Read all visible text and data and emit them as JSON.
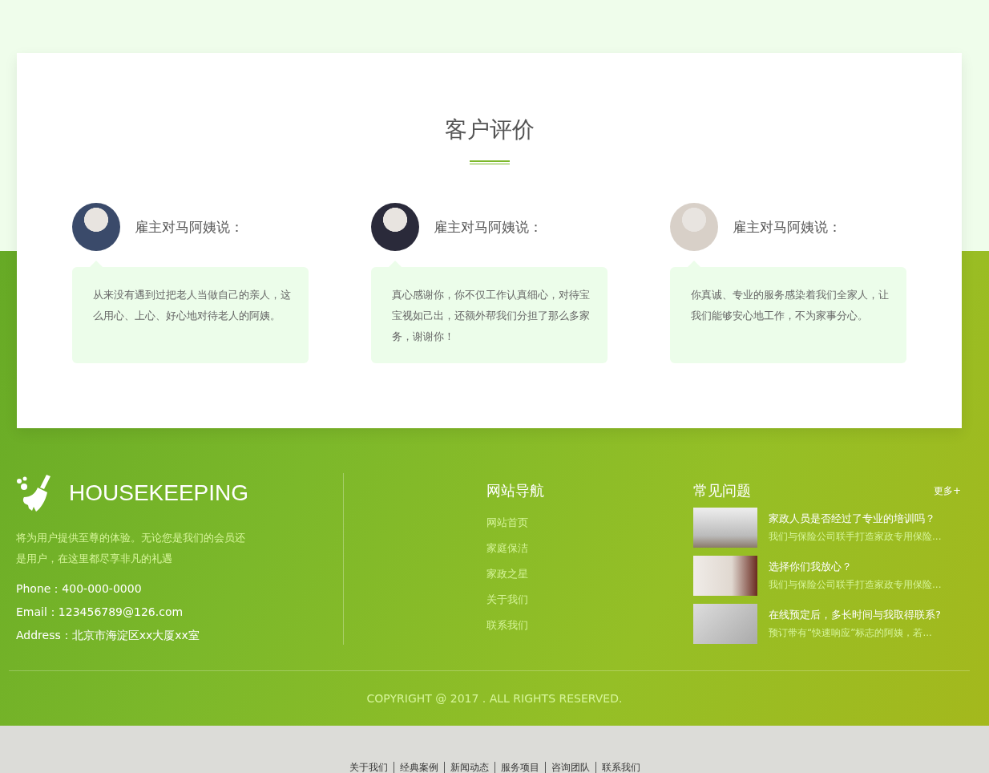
{
  "section": {
    "title": "客户评价"
  },
  "testimonials": [
    {
      "label": "雇主对马阿姨说：",
      "text": "从来没有遇到过把老人当做自己的亲人，这么用心、上心、好心地对待老人的阿姨。"
    },
    {
      "label": "雇主对马阿姨说：",
      "text": "真心感谢你，你不仅工作认真细心，对待宝宝视如己出，还额外帮我们分担了那么多家务，谢谢你！"
    },
    {
      "label": "雇主对马阿姨说：",
      "text": "你真诚、专业的服务感染着我们全家人，让我们能够安心地工作，不为家事分心。"
    }
  ],
  "footer": {
    "logo": "HOUSEKEEPING",
    "description": "将为用户提供至尊的体验。无论您是我们的会员还是用户，在这里都尽享非凡的礼遇",
    "contacts": [
      "Phone：400-000-0000",
      "Email：123456789@126.com",
      "Address：北京市海淀区xx大厦xx室"
    ],
    "nav": {
      "title": "网站导航",
      "items": [
        "网站首页",
        "家庭保洁",
        "家政之星",
        "关于我们",
        "联系我们"
      ]
    },
    "faq": {
      "title": "常见问题",
      "more": "更多+",
      "items": [
        {
          "title": "家政人员是否经过了专业的培训吗？",
          "summary": "我们与保险公司联手打造家政专用保险..."
        },
        {
          "title": "选择你们我放心？",
          "summary": "我们与保险公司联手打造家政专用保险..."
        },
        {
          "title": "在线预定后，多长时间与我取得联系?",
          "summary": "预订带有“快速响应”标志的阿姨，若..."
        }
      ]
    },
    "copyright": "COPYRIGHT @ 2017 . ALL RIGHTS RESERVED."
  },
  "bottom_links": [
    "关于我们",
    "经典案例",
    "新闻动态",
    "服务项目",
    "咨询团队",
    "联系我们"
  ]
}
